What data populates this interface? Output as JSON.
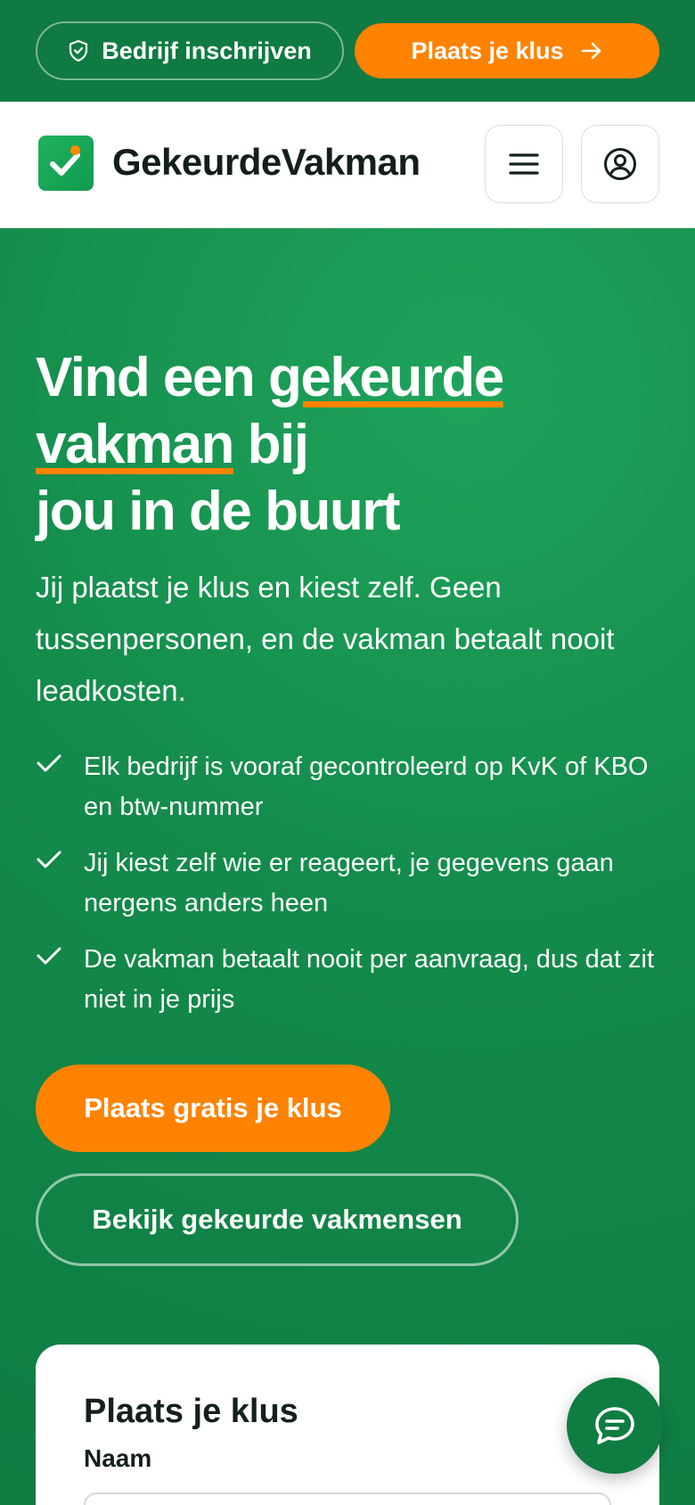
{
  "topbar": {
    "register_label": "Bedrijf inschrijven",
    "post_job_label": "Plaats je klus"
  },
  "header": {
    "brand": "GekeurdeVakman"
  },
  "hero": {
    "title_part1": "Vind een ",
    "title_highlight1": "gekeurde",
    "title_highlight2": "vakman",
    "title_part2": " bij",
    "title_part3": "jou in de buurt",
    "subtitle": "Jij plaatst je klus en kiest zelf. Geen tussenpersonen, en de vakman betaalt nooit leadkosten.",
    "features": [
      "Elk bedrijf is vooraf gecontroleerd op KvK of KBO en btw-nummer",
      "Jij kiest zelf wie er reageert, je gegevens gaan nergens anders heen",
      "De vakman betaalt nooit per aanvraag, dus dat zit niet in je prijs"
    ],
    "cta_label": "Plaats gratis je klus",
    "secondary_label": "Bekijk gekeurde vakmensen"
  },
  "form": {
    "title": "Plaats je klus",
    "name_label": "Naam"
  },
  "icons": {
    "register": "shield-check-icon",
    "arrow": "arrow-right-icon",
    "logo": "checkmark-logo-icon",
    "menu": "hamburger-menu-icon",
    "account": "user-circle-icon",
    "feature": "checkmark-icon",
    "chat": "chat-bubble-icon"
  },
  "colors": {
    "brand_green": "#128a4c",
    "accent_orange": "#ff8200",
    "dark_text": "#13201a"
  }
}
